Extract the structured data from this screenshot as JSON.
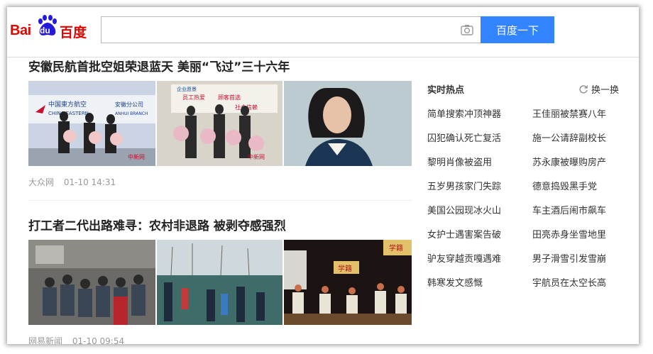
{
  "header": {
    "logo": {
      "latin": "Bai",
      "du": "du",
      "chinese": "百度"
    },
    "search": {
      "value": "",
      "placeholder": ""
    },
    "search_button": "百度一下"
  },
  "articles": [
    {
      "title": "安徽民航首批空姐荣退蓝天 美丽“飞过”三十六年",
      "source": "大众网",
      "time": "01-10 14:31",
      "image_text": [
        "中国東方航空",
        "安徽分公司",
        "CHINA EASTERN",
        "ANHUI BRANCH",
        "企业愿景",
        "员工热爱",
        "顾客首选",
        "社会信赖",
        "中新网",
        "chinanews.com"
      ]
    },
    {
      "title": "打工者二代出路难寻：农村非退路 被剥夺感强烈",
      "source": "网易新闻",
      "time": "01-10 09:54",
      "image_text": [
        "学籍",
        "学籍"
      ]
    }
  ],
  "hot": {
    "title": "实时热点",
    "refresh": "换一换",
    "items": [
      "简单搜索冲顶神器",
      "王佳丽被禁赛八年",
      "囚犯确认死亡复活",
      "施一公请辞副校长",
      "黎明肖像被盗用",
      "苏永康被曝购房产",
      "五岁男孩家门失踪",
      "德意捣毁黑手党",
      "美国公园现冰火山",
      "车主酒后闹市飙车",
      "女护士遇害案告破",
      "田亮赤身坐雪地里",
      "驴友穿越贡嘎遇难",
      "男子滑雪引发雪崩",
      "韩寒发文感慨",
      "宇航员在太空长高"
    ]
  },
  "colors": {
    "brand_red": "#e10601",
    "brand_blue": "#3385ff"
  }
}
